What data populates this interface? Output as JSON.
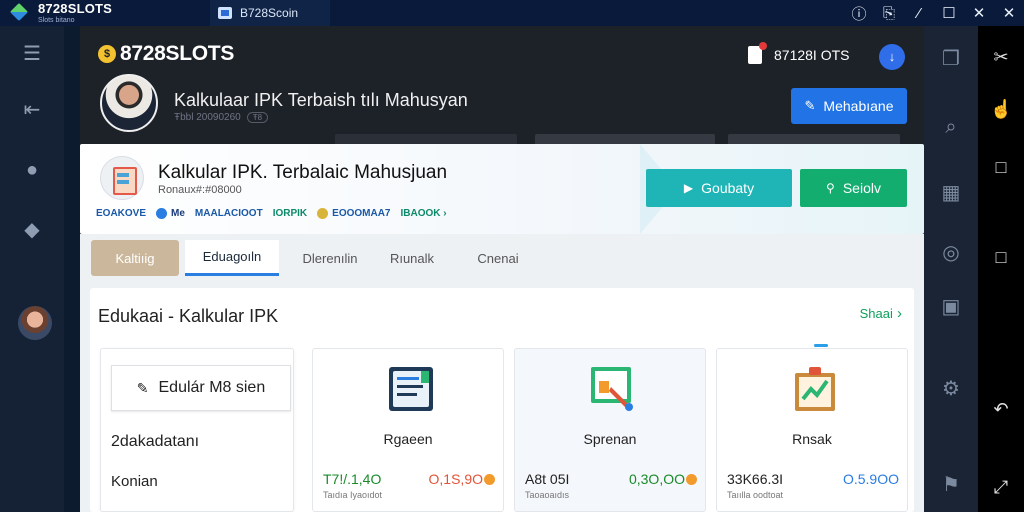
{
  "window": {
    "brand_name": "8728SLOTS",
    "brand_sub": "Slots bitano",
    "tab_label": "B728Scoin",
    "controls": [
      "ⓘ",
      "⎘",
      "⁄",
      "☐",
      "✕",
      "✕"
    ]
  },
  "app": {
    "logo_text": "8728SLOTS",
    "profile_title": "Kalkulaar IPK Terbaish tılı Mahusyan",
    "profile_sub": "Ŧbbl 20090260",
    "profile_pill": "Ŧ8",
    "notif_text": "87128I OTS",
    "help_icon": "help-icon",
    "header_button": "Mehabıane"
  },
  "banner": {
    "title": "Kalkular IPK. Terbalaic Mahusjuan",
    "subtitle": "Ronaux#:#08000",
    "badges": [
      {
        "label": "EOAKOVE",
        "color": "#1a58a8"
      },
      {
        "label": "Me",
        "color": "#1a3a7a"
      },
      {
        "label": "MAALACIOOT",
        "color": "#1a58a8"
      },
      {
        "label": "IORPIK",
        "color": "#0c8a6a"
      },
      {
        "label": "EOOOMAA7",
        "color": "#1a58a8"
      },
      {
        "label": "IBAOOK ›",
        "color": "#0c8a6a"
      }
    ],
    "button_primary": "Goubaty",
    "button_secondary": "Seiolv"
  },
  "tabs": [
    "Kaltiıig",
    "Eduagoıln",
    "Dlerenılin",
    "Rıunalk",
    "Cnenai"
  ],
  "section": {
    "title": "Edukaai - Kalkular IPK",
    "link": "Shaai",
    "left_button": "Edulár M8 sien",
    "left_text_1": "2dakadatanı",
    "left_text_2": "Konian"
  },
  "cards": [
    {
      "name": "Rgaeen",
      "value_left": "T7!/.1,4O",
      "value_right": "O,1S,9O",
      "note": "Taıdıa Iyaoıdot",
      "left_color": "#1a8a2a",
      "right_color": "#e0553a",
      "icon": "calculator-icon"
    },
    {
      "name": "Sprenan",
      "value_left": "A8t 05I",
      "value_right": "0,3O,OO",
      "note": "Taoaoaıdıs",
      "left_color": "#222222",
      "right_color": "#1a8a2a",
      "icon": "chart-icon"
    },
    {
      "name": "Rnsak",
      "value_left": "33K66.3I",
      "value_right": "O.5.9OO",
      "note": "Taıılla oodtoat",
      "left_color": "#222222",
      "right_color": "#2a7de1",
      "icon": "growth-icon"
    }
  ]
}
